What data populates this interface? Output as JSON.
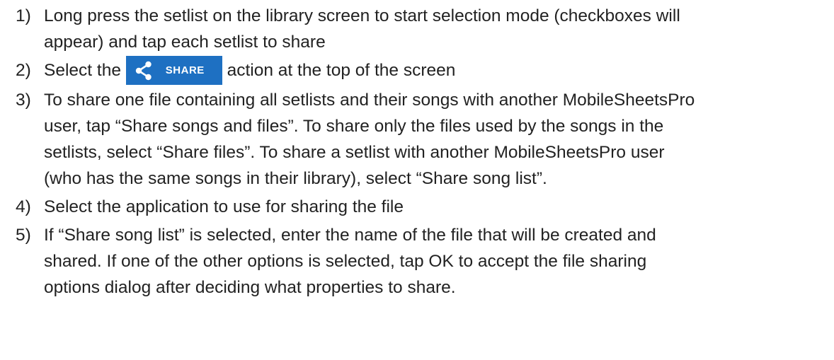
{
  "steps": [
    {
      "num": "1)",
      "lines": [
        "Long press the setlist on the library screen to start selection mode (checkboxes will",
        "appear) and tap each setlist to share"
      ]
    },
    {
      "num": "2)",
      "before": "Select the",
      "after": "action at the top of the screen",
      "button": {
        "label": "SHARE",
        "icon": "share-icon",
        "color": "#1e70c2"
      }
    },
    {
      "num": "3)",
      "lines": [
        "To share one file containing all setlists and their songs with another MobileSheetsPro",
        "user, tap “Share songs and files”. To share only the files used by the songs in the",
        "setlists, select “Share files”. To share a setlist with another MobileSheetsPro user",
        "(who has the same songs in their library), select “Share song list”."
      ]
    },
    {
      "num": "4)",
      "lines": [
        "Select the application to use for sharing the file"
      ]
    },
    {
      "num": "5)",
      "lines": [
        "If “Share song list” is selected, enter the name of the file that will be created and",
        "shared. If one of the other options is selected, tap OK to accept the file sharing",
        "options dialog after deciding what properties to share."
      ]
    }
  ]
}
